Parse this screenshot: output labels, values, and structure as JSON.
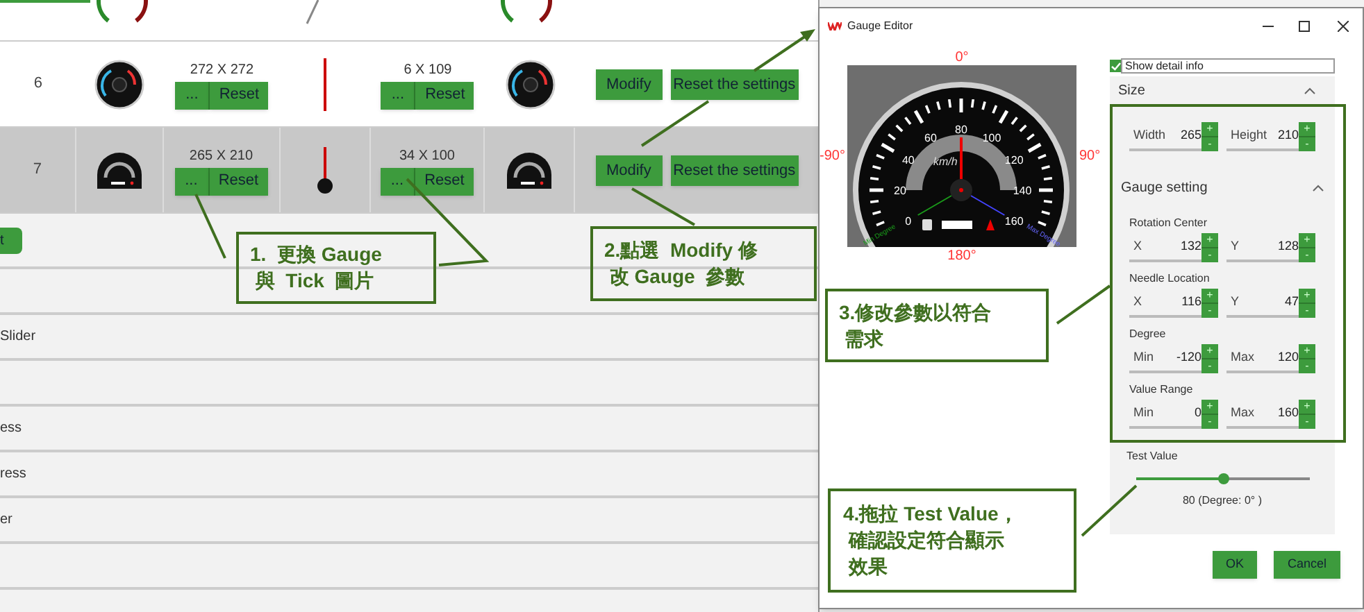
{
  "table": {
    "rows": [
      {
        "number": "6",
        "gauge_size": "272 X 272",
        "tick_size": "6 X 109",
        "selected": false,
        "kind": "round",
        "gauge_buttons": {
          "browse": "...",
          "reset": "Reset"
        },
        "tick_buttons": {
          "browse": "...",
          "reset": "Reset"
        },
        "modify": "Modify",
        "reset_settings": "Reset the settings"
      },
      {
        "number": "7",
        "gauge_size": "265 X 210",
        "tick_size": "34 X 100",
        "selected": true,
        "kind": "half",
        "gauge_buttons": {
          "browse": "...",
          "reset": "Reset"
        },
        "tick_buttons": {
          "browse": "...",
          "reset": "Reset"
        },
        "modify": "Modify",
        "reset_settings": "Reset the settings"
      }
    ]
  },
  "list": [
    {
      "kind": "button",
      "label": "t"
    },
    {
      "kind": "blank"
    },
    {
      "kind": "text",
      "label": "Slider"
    },
    {
      "kind": "blank"
    },
    {
      "kind": "text",
      "label": "ess"
    },
    {
      "kind": "text",
      "label": "ress"
    },
    {
      "kind": "text",
      "label": "er"
    },
    {
      "kind": "blank"
    },
    {
      "kind": "blank"
    }
  ],
  "dialog": {
    "title": "Gauge Editor",
    "preview": {
      "top": "0°",
      "left": "-90°",
      "right": "90°",
      "bottom": "180°",
      "scale": [
        "0",
        "20",
        "40",
        "60",
        "80",
        "100",
        "120",
        "140",
        "160"
      ],
      "unit": "km/h",
      "min_label": "Min Degree",
      "max_label": "Max Degree"
    },
    "detail_checkbox": {
      "label": "Show detail info",
      "checked": true
    },
    "sections": [
      {
        "title": "Size",
        "expanded": true,
        "groups": [
          {
            "fields": [
              {
                "label": "Width",
                "value": "265",
                "up": "+",
                "down": "-"
              },
              {
                "label": "Height",
                "value": "210",
                "up": "+",
                "down": "-"
              }
            ]
          }
        ]
      },
      {
        "title": "Gauge setting",
        "expanded": true,
        "groups": [
          {
            "title": "Rotation Center",
            "fields": [
              {
                "label": "X",
                "value": "132",
                "up": "+",
                "down": "-"
              },
              {
                "label": "Y",
                "value": "128",
                "up": "+",
                "down": "-"
              }
            ]
          },
          {
            "title": "Needle Location",
            "fields": [
              {
                "label": "X",
                "value": "116",
                "up": "+",
                "down": "-"
              },
              {
                "label": "Y",
                "value": "47",
                "up": "+",
                "down": "-"
              }
            ]
          },
          {
            "title": "Degree",
            "fields": [
              {
                "label": "Min",
                "value": "-120",
                "up": "+",
                "down": "-"
              },
              {
                "label": "Max",
                "value": "120",
                "up": "+",
                "down": "-"
              }
            ]
          },
          {
            "title": "Value Range",
            "fields": [
              {
                "label": "Min",
                "value": "0",
                "up": "+",
                "down": "-"
              },
              {
                "label": "Max",
                "value": "160",
                "up": "+",
                "down": "-"
              }
            ]
          }
        ]
      }
    ],
    "test_value": {
      "label": "Test Value",
      "level": 0.5,
      "reading": "80 (Degree: 0° )"
    },
    "buttons": [
      "OK",
      "Cancel"
    ]
  },
  "callouts": [
    {
      "lines": [
        "1.  更換 Gauge",
        "與  Tick  圖片"
      ]
    },
    {
      "lines": [
        "2.點選  Modify 修",
        "改 Gauge  參數"
      ]
    },
    {
      "lines": [
        "3.修改參數以符合",
        "需求"
      ]
    },
    {
      "lines": [
        "4.拖拉 Test Value，",
        "確認設定符合顯示",
        "效果"
      ]
    }
  ]
}
